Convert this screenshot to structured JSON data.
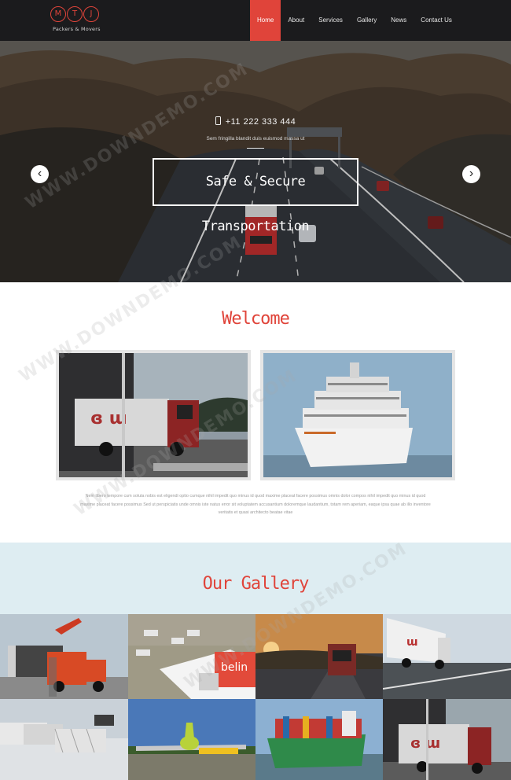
{
  "brand": {
    "letters": [
      "M",
      "T",
      "J"
    ],
    "tagline": "Packers & Movers",
    "accent_color": "#e0443a"
  },
  "nav": {
    "items": [
      {
        "label": "Home",
        "active": true
      },
      {
        "label": "About",
        "active": false
      },
      {
        "label": "Services",
        "active": false
      },
      {
        "label": "Gallery",
        "active": false
      },
      {
        "label": "News",
        "active": false
      },
      {
        "label": "Contact Us",
        "active": false
      }
    ]
  },
  "hero": {
    "phone": "+11 222 333 444",
    "phone_icon": "mobile-phone-icon",
    "subtitle": "Sem fringilla blandit duis euismod massa ut",
    "headline": "Safe & Secure Transportation",
    "prev_icon": "chevron-left-icon",
    "next_icon": "chevron-right-icon",
    "prev_glyph": "‹",
    "next_glyph": "›"
  },
  "welcome": {
    "title": "Welcome",
    "images": [
      "truck-photo",
      "cruise-ship-photo"
    ],
    "paragraph": "Nem libero tempore cum soluta nobis est eligendi optio cumque nihil impedit quo minus id quod maxime placeat facere possimus omnis dolor compos nihil impedit quo minus id quod maxime placeat facere possimus Sed ut perspiciatis unde omnis iste natus error sit voluptatem accusantium doloremque laudantium, totam rem aperiam, eaque ipsa quae ab illo inventore veritatis et quasi architecto beatae vitae"
  },
  "gallery": {
    "title": "Our Gallery",
    "tiles": [
      "red-truck-crane-photo",
      "airport-apron-photo",
      "sunset-truck-photo",
      "white-lorry-highway-photo",
      "cargo-loading-photo",
      "green-airplane-photo",
      "container-ship-photo",
      "truck-closeup-photo"
    ]
  },
  "watermark": "WWW.DOWNDEMO.COM"
}
